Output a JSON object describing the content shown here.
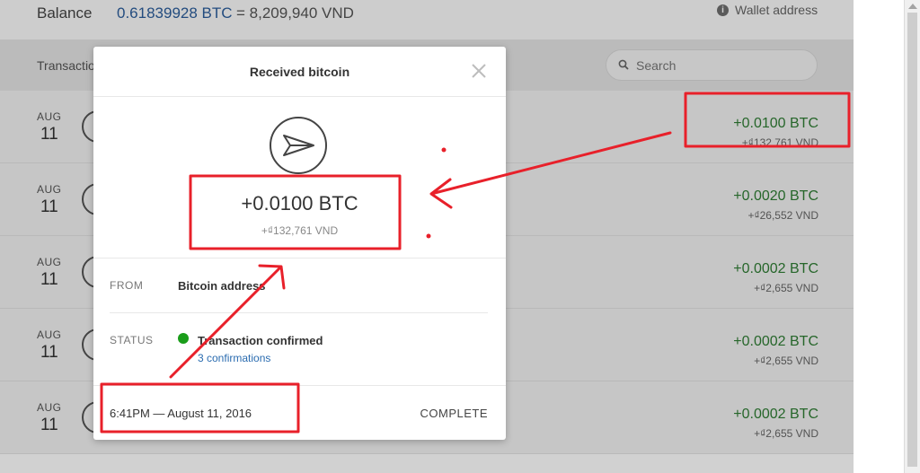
{
  "header": {
    "balance_label": "Balance",
    "balance_btc": "0.61839928 BTC",
    "balance_vnd": "= 8,209,940 VND",
    "info_icon_glyph": "i",
    "wallet_address_label": "Wallet address"
  },
  "transactions": {
    "title": "Transactions",
    "search_placeholder": "Search",
    "rows": [
      {
        "month": "AUG",
        "day": "11",
        "amount": "+0.0100 BTC",
        "fiat": "+₫132,761 VND"
      },
      {
        "month": "AUG",
        "day": "11",
        "amount": "+0.0020 BTC",
        "fiat": "+₫26,552 VND"
      },
      {
        "month": "AUG",
        "day": "11",
        "amount": "+0.0002 BTC",
        "fiat": "+₫2,655 VND"
      },
      {
        "month": "AUG",
        "day": "11",
        "amount": "+0.0002 BTC",
        "fiat": "+₫2,655 VND"
      },
      {
        "month": "AUG",
        "day": "11",
        "amount": "+0.0002 BTC",
        "fiat": "+₫2,655 VND"
      }
    ]
  },
  "modal": {
    "title": "Received bitcoin",
    "icon": "send-icon",
    "amount": "+0.0100 BTC",
    "fiat": "+₫132,761 VND",
    "from_label": "FROM",
    "from_value": "Bitcoin address",
    "status_label": "STATUS",
    "status_text": "Transaction confirmed",
    "confirmations": "3 confirmations",
    "date": "6:41PM — August 11, 2016",
    "complete_label": "COMPLETE"
  },
  "colors": {
    "positive": "#2f7d34",
    "link": "#2b6cb0",
    "annotation": "#e8202a",
    "status_dot": "#1a9d1a"
  }
}
